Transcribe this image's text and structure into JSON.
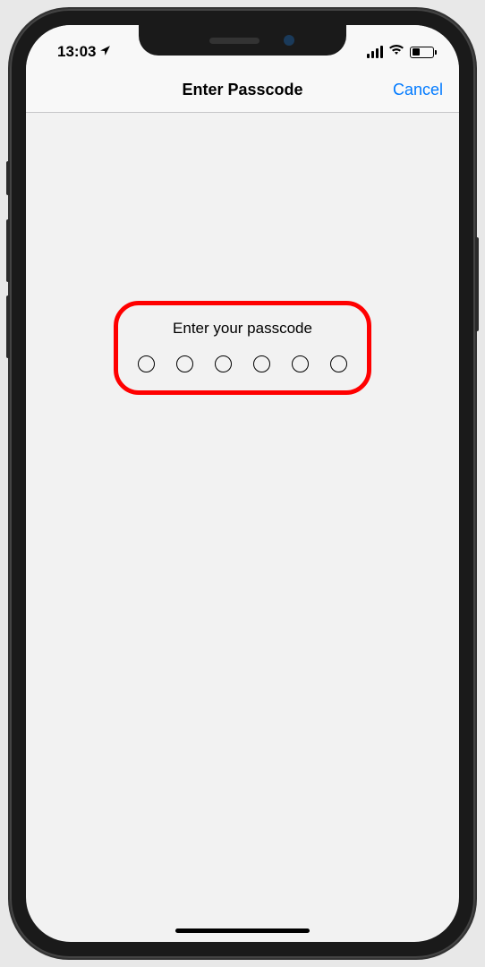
{
  "statusBar": {
    "time": "13:03",
    "locationIcon": "location-arrow-icon",
    "signalIcon": "cellular-signal-icon",
    "wifiIcon": "wifi-icon",
    "batteryIcon": "battery-icon"
  },
  "navBar": {
    "title": "Enter Passcode",
    "cancelLabel": "Cancel"
  },
  "passcode": {
    "prompt": "Enter your passcode",
    "dotCount": 6
  },
  "annotation": {
    "highlightColor": "#ff0000"
  }
}
